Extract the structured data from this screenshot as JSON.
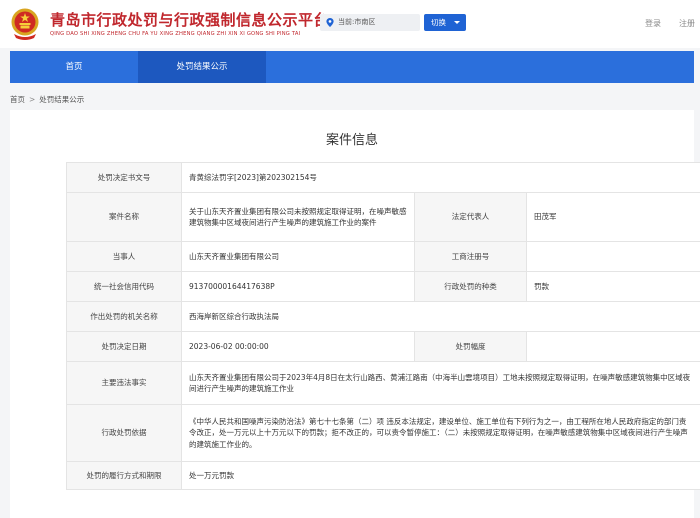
{
  "header": {
    "title": "青岛市行政处罚与行政强制信息公示平台",
    "subtitle": "QING DAO SHI XING ZHENG CHU FA YU XING ZHENG QIANG ZHI XIN XI GONG SHI PING TAI",
    "location_label": "当前:市南区",
    "switch_label": "切换",
    "login_label": "登录",
    "register_label": "注册"
  },
  "nav": {
    "home": "首页",
    "active": "处罚结果公示"
  },
  "breadcrumb": {
    "home": "首页",
    "separator": ">",
    "current": "处罚结果公示"
  },
  "panel": {
    "title": "案件信息"
  },
  "case": {
    "doc_no_label": "处罚决定书文号",
    "doc_no": "青黄综法罚字[2023]第202302154号",
    "case_name_label": "案件名称",
    "case_name": "关于山东天齐置业集团有限公司未按照规定取得证明，在噪声敏感建筑物集中区域夜间进行产生噪声的建筑施工作业的案件",
    "legal_rep_label": "法定代表人",
    "legal_rep": "田茂军",
    "party_label": "当事人",
    "party": "山东天齐置业集团有限公司",
    "biz_reg_label": "工商注册号",
    "biz_reg": "",
    "credit_code_label": "统一社会信用代码",
    "credit_code": "91370000164417638P",
    "penalty_type_label": "行政处罚的种类",
    "penalty_type": "罚款",
    "authority_label": "作出处罚的机关名称",
    "authority": "西海岸新区综合行政执法局",
    "date_label": "处罚决定日期",
    "date": "2023-06-02 00:00:00",
    "range_label": "处罚幅度",
    "range": "",
    "facts_label": "主要违法事实",
    "facts": "山东天齐置业集团有限公司于2023年4月8日在太行山路西、黄浦江路南（中海半山雲境项目）工地未按照规定取得证明，在噪声敏感建筑物集中区域夜间进行产生噪声的建筑施工作业",
    "basis_label": "行政处罚依据",
    "basis": "《中华人民共和国噪声污染防治法》第七十七条第（二）项 违反本法规定，建设单位、施工单位有下列行为之一，由工程所在地人民政府指定的部门责令改正，处一万元以上十万元以下的罚款；拒不改正的，可以责令暂停施工：（二）未按照规定取得证明，在噪声敏感建筑物集中区域夜间进行产生噪声的建筑施工作业的。",
    "performance_label": "处罚的履行方式和期限",
    "performance": "处一万元罚款"
  },
  "colors": {
    "brand_red": "#c0272d",
    "nav_blue": "#2b6fdc",
    "nav_active": "#1d58bf",
    "switch_blue": "#1f63d4"
  },
  "icons": {
    "emblem": "national-emblem-icon",
    "location": "location-pin-icon",
    "caret": "caret-down-icon"
  }
}
